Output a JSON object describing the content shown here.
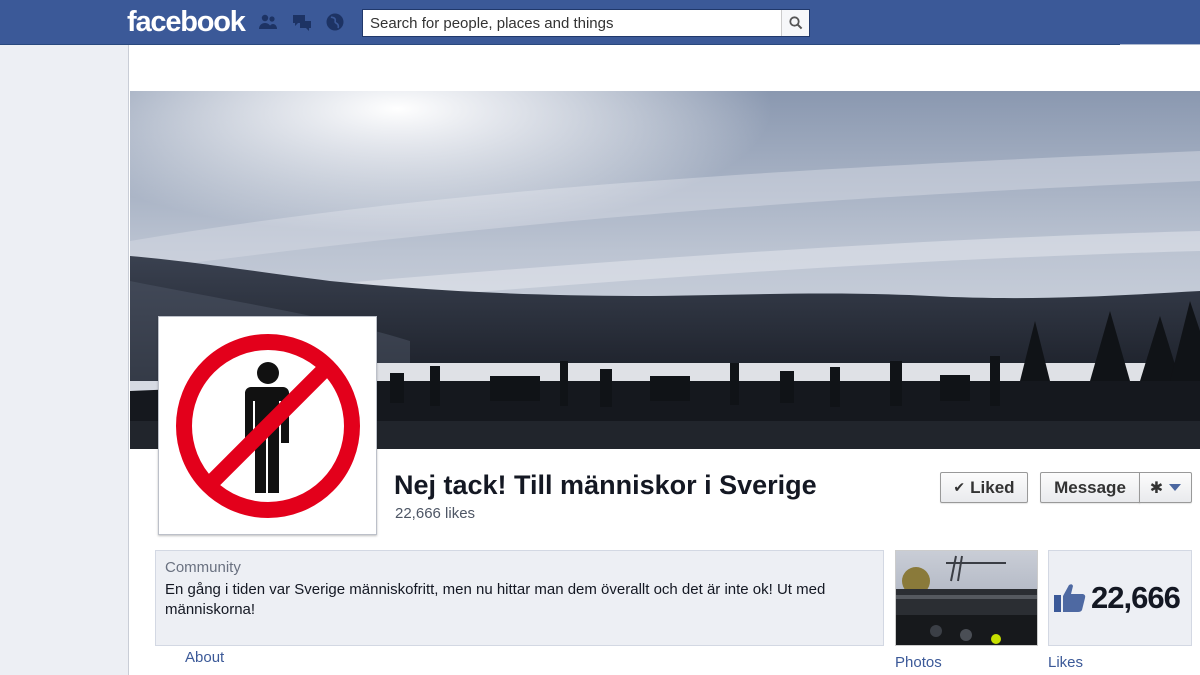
{
  "header": {
    "logo": "facebook",
    "search_placeholder": "Search for people, places and things"
  },
  "page": {
    "name": "Nej tack! Till människor i Sverige",
    "likes_text": "22,666 likes",
    "category": "Community",
    "description": "En gång i tiden var Sverige människofritt, men nu hittar man dem överallt och det är inte ok! Ut med människorna!"
  },
  "buttons": {
    "liked": "Liked",
    "message": "Message"
  },
  "tabs": {
    "about": "About",
    "photos": "Photos",
    "likes": "Likes",
    "likes_count": "22,666"
  },
  "icons": {
    "friends": "friends-icon",
    "messages": "messages-icon",
    "notifications": "globe-icon",
    "search": "magnifier-icon",
    "liked": "checkmark-icon",
    "gear": "gear-icon",
    "caret": "caret-down-icon",
    "thumb": "thumbs-up-icon"
  },
  "colors": {
    "brand": "#3b5998",
    "prohibition_red": "#e3001b"
  }
}
